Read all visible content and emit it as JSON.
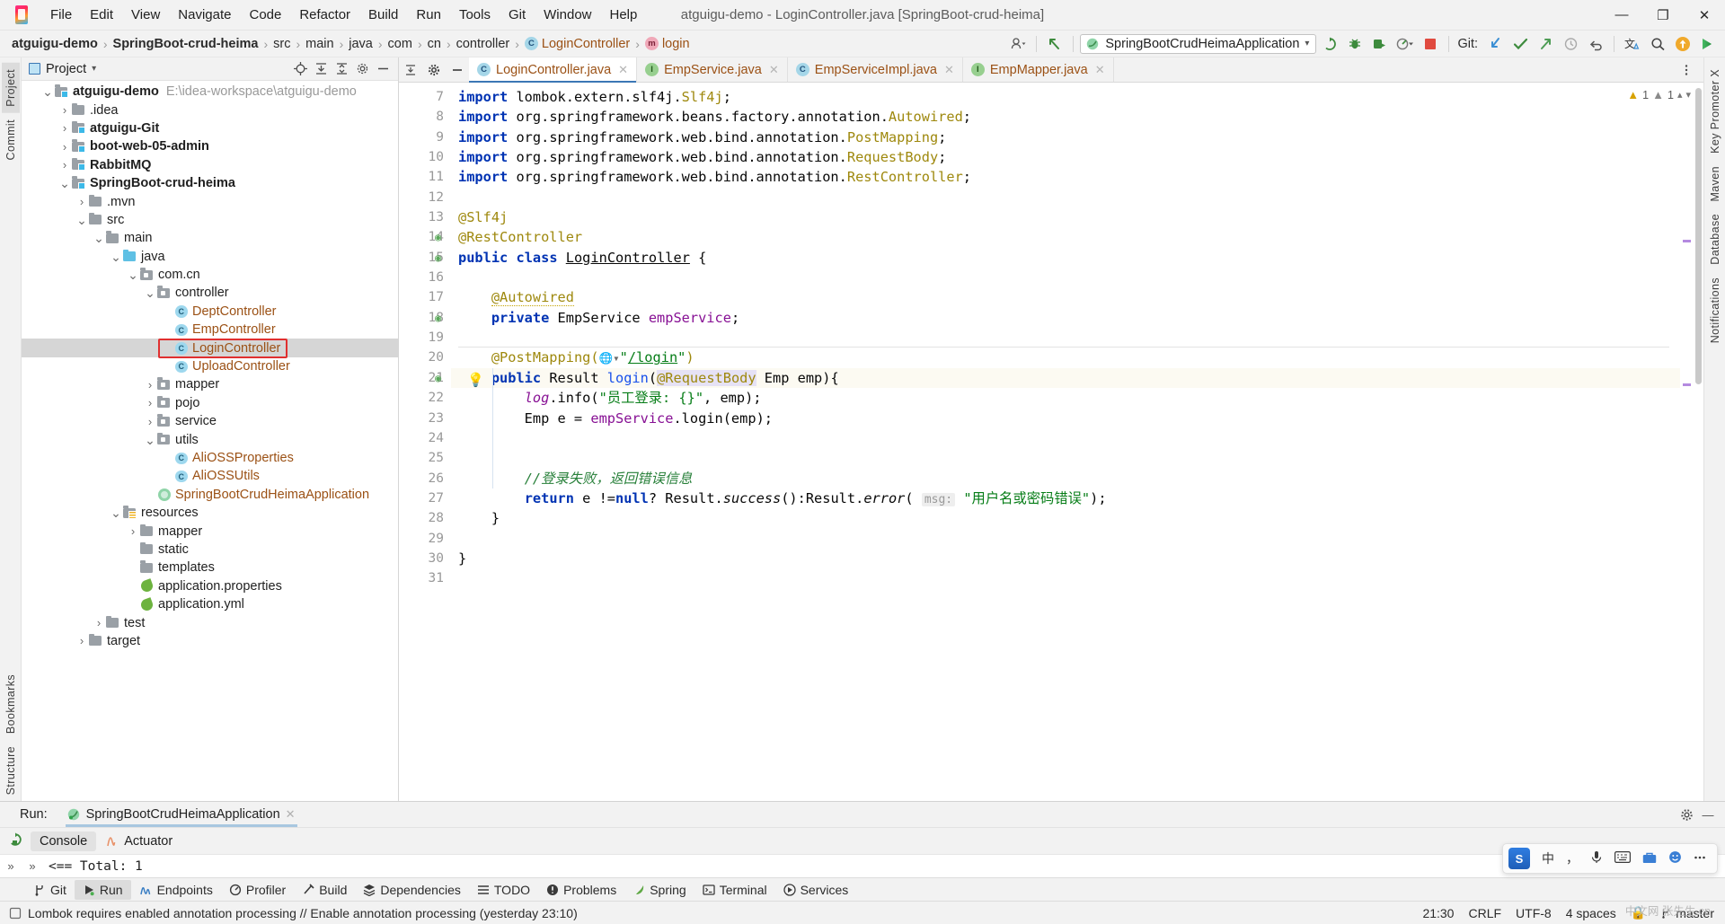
{
  "titlebar": {
    "window_title": "atguigu-demo - LoginController.java [SpringBoot-crud-heima]",
    "menus": [
      "File",
      "Edit",
      "View",
      "Navigate",
      "Code",
      "Refactor",
      "Build",
      "Run",
      "Tools",
      "Git",
      "Window",
      "Help"
    ],
    "minimize": "—",
    "maximize": "❐",
    "close": "✕"
  },
  "navbar": {
    "crumbs": [
      {
        "label": "atguigu-demo",
        "style": "bold"
      },
      {
        "label": "SpringBoot-crud-heima",
        "style": "bold"
      },
      {
        "label": "src",
        "style": "plain"
      },
      {
        "label": "main",
        "style": "plain"
      },
      {
        "label": "java",
        "style": "plain"
      },
      {
        "label": "com",
        "style": "plain"
      },
      {
        "label": "cn",
        "style": "plain"
      },
      {
        "label": "controller",
        "style": "plain"
      },
      {
        "label": "LoginController",
        "style": "class",
        "icon": "c"
      },
      {
        "label": "login",
        "style": "method",
        "icon": "m"
      }
    ],
    "separator": "›",
    "run_config": "SpringBootCrudHeimaApplication",
    "run_config_caret": "▾",
    "git_label": "Git:",
    "toolbar_icons": [
      "user-avatar-icon",
      "undo-arrow-icon",
      "run-icon",
      "debug-icon",
      "run-coverage-icon",
      "profiler-icon",
      "stop-icon",
      "git-update-icon",
      "git-commit-icon",
      "git-push-icon",
      "history-icon",
      "rollback-icon",
      "translate-icon",
      "search-icon",
      "updates-icon",
      "feature-trainer-icon"
    ]
  },
  "left_rail": {
    "tabs": [
      "Project",
      "Commit"
    ],
    "bottom_tabs": [
      "Bookmarks",
      "Structure"
    ]
  },
  "right_rail": {
    "tabs": [
      "Key Promoter X",
      "Maven",
      "Database",
      "Notifications"
    ]
  },
  "project_panel": {
    "title": "Project",
    "caret": "▾",
    "header_icons": [
      "locate-icon",
      "collapse-all-icon",
      "expand-all-icon",
      "settings-icon",
      "hide-icon"
    ],
    "tree": [
      {
        "depth": 0,
        "arrow": "v",
        "icon": "module",
        "label": "atguigu-demo",
        "bold": true,
        "path": "E:\\idea-workspace\\atguigu-demo"
      },
      {
        "depth": 1,
        "arrow": ">",
        "icon": "folder",
        "label": ".idea",
        "bold": false
      },
      {
        "depth": 1,
        "arrow": ">",
        "icon": "module",
        "label": "atguigu-Git",
        "bold": true
      },
      {
        "depth": 1,
        "arrow": ">",
        "icon": "module",
        "label": "boot-web-05-admin",
        "bold": true
      },
      {
        "depth": 1,
        "arrow": ">",
        "icon": "module",
        "label": "RabbitMQ",
        "bold": true
      },
      {
        "depth": 1,
        "arrow": "v",
        "icon": "module",
        "label": "SpringBoot-crud-heima",
        "bold": true
      },
      {
        "depth": 2,
        "arrow": ">",
        "icon": "folder",
        "label": ".mvn",
        "bold": false
      },
      {
        "depth": 2,
        "arrow": "v",
        "icon": "folder",
        "label": "src",
        "bold": false
      },
      {
        "depth": 3,
        "arrow": "v",
        "icon": "folder",
        "label": "main",
        "bold": false
      },
      {
        "depth": 4,
        "arrow": "v",
        "icon": "source",
        "label": "java",
        "bold": false
      },
      {
        "depth": 5,
        "arrow": "v",
        "icon": "package",
        "label": "com.cn",
        "bold": false
      },
      {
        "depth": 6,
        "arrow": "v",
        "icon": "package",
        "label": "controller",
        "bold": false
      },
      {
        "depth": 7,
        "arrow": "",
        "icon": "class",
        "label": "DeptController",
        "bold": false
      },
      {
        "depth": 7,
        "arrow": "",
        "icon": "class",
        "label": "EmpController",
        "bold": false
      },
      {
        "depth": 7,
        "arrow": "",
        "icon": "class",
        "label": "LoginController",
        "bold": false,
        "selected": true,
        "highlight": true
      },
      {
        "depth": 7,
        "arrow": "",
        "icon": "class",
        "label": "UploadController",
        "bold": false
      },
      {
        "depth": 6,
        "arrow": ">",
        "icon": "package",
        "label": "mapper",
        "bold": false
      },
      {
        "depth": 6,
        "arrow": ">",
        "icon": "package",
        "label": "pojo",
        "bold": false
      },
      {
        "depth": 6,
        "arrow": ">",
        "icon": "package",
        "label": "service",
        "bold": false
      },
      {
        "depth": 6,
        "arrow": "v",
        "icon": "package",
        "label": "utils",
        "bold": false
      },
      {
        "depth": 7,
        "arrow": "",
        "icon": "class",
        "label": "AliOSSProperties",
        "bold": false
      },
      {
        "depth": 7,
        "arrow": "",
        "icon": "class",
        "label": "AliOSSUtils",
        "bold": false
      },
      {
        "depth": 6,
        "arrow": "",
        "icon": "spring",
        "label": "SpringBootCrudHeimaApplication",
        "bold": false
      },
      {
        "depth": 4,
        "arrow": "v",
        "icon": "resource",
        "label": "resources",
        "bold": false
      },
      {
        "depth": 5,
        "arrow": ">",
        "icon": "folder",
        "label": "mapper",
        "bold": false
      },
      {
        "depth": 5,
        "arrow": "",
        "icon": "folder",
        "label": "static",
        "bold": false
      },
      {
        "depth": 5,
        "arrow": "",
        "icon": "folder",
        "label": "templates",
        "bold": false
      },
      {
        "depth": 5,
        "arrow": "",
        "icon": "props",
        "label": "application.properties",
        "bold": false
      },
      {
        "depth": 5,
        "arrow": "",
        "icon": "props",
        "label": "application.yml",
        "bold": false
      },
      {
        "depth": 3,
        "arrow": ">",
        "icon": "folder",
        "label": "test",
        "bold": false
      },
      {
        "depth": 2,
        "arrow": ">",
        "icon": "folder",
        "label": "target",
        "bold": false
      }
    ]
  },
  "editor": {
    "tabs": [
      {
        "label": "LoginController.java",
        "icon": "c",
        "active": true
      },
      {
        "label": "EmpService.java",
        "icon": "i",
        "active": false
      },
      {
        "label": "EmpServiceImpl.java",
        "icon": "c",
        "active": false
      },
      {
        "label": "EmpMapper.java",
        "icon": "i",
        "active": false
      }
    ],
    "close_glyph": "✕",
    "inspection": {
      "warnings": "1",
      "weak_warnings": "1",
      "warn_glyph": "⚠",
      "check_glyph": "✓"
    },
    "first_line_number": 7,
    "lines": [
      {
        "n": 7,
        "text": "import lombok.extern.slf4j.Slf4j;"
      },
      {
        "n": 8,
        "text": "import org.springframework.beans.factory.annotation.Autowired;"
      },
      {
        "n": 9,
        "text": "import org.springframework.web.bind.annotation.PostMapping;"
      },
      {
        "n": 10,
        "text": "import org.springframework.web.bind.annotation.RequestBody;"
      },
      {
        "n": 11,
        "text": "import org.springframework.web.bind.annotation.RestController;"
      },
      {
        "n": 12,
        "text": ""
      },
      {
        "n": 13,
        "text": "@Slf4j"
      },
      {
        "n": 14,
        "text": "@RestController"
      },
      {
        "n": 15,
        "text": "public class LoginController {"
      },
      {
        "n": 16,
        "text": ""
      },
      {
        "n": 17,
        "text": "    @Autowired"
      },
      {
        "n": 18,
        "text": "    private EmpService empService;"
      },
      {
        "n": 19,
        "text": ""
      },
      {
        "n": 20,
        "text": "    @PostMapping(\"/login\")"
      },
      {
        "n": 21,
        "text": "    public Result login(@RequestBody Emp emp){"
      },
      {
        "n": 22,
        "text": "        log.info(\"员工登录: {}\", emp);"
      },
      {
        "n": 23,
        "text": "        Emp e = empService.login(emp);"
      },
      {
        "n": 24,
        "text": ""
      },
      {
        "n": 25,
        "text": ""
      },
      {
        "n": 26,
        "text": "        //登录失败，返回错误信息"
      },
      {
        "n": 27,
        "text": "        return e !=null? Result.success():Result.error( msg: \"用户名或密码错误\");"
      },
      {
        "n": 28,
        "text": "    }"
      },
      {
        "n": 29,
        "text": ""
      },
      {
        "n": 30,
        "text": "}"
      },
      {
        "n": 31,
        "text": ""
      }
    ],
    "param_hint": "msg:",
    "url_literal": "/login",
    "globe_glyph": "ἱ0"
  },
  "run_panel": {
    "label": "Run:",
    "config_name": "SpringBootCrudHeimaApplication",
    "close_glyph": "✕",
    "tabs": [
      "Console",
      "Actuator"
    ],
    "active_tab": "Console",
    "console_line": "<==      Total: 1",
    "chevrons": [
      "»",
      "»"
    ],
    "settings_glyph": "⚙",
    "hide_glyph": "—"
  },
  "toolwindow_bar": {
    "items": [
      {
        "label": "Git",
        "icon": "git-branch-icon",
        "active": false
      },
      {
        "label": "Run",
        "icon": "run-play-icon",
        "active": true
      },
      {
        "label": "Endpoints",
        "icon": "endpoints-icon",
        "active": false
      },
      {
        "label": "Profiler",
        "icon": "profiler-icon",
        "active": false
      },
      {
        "label": "Build",
        "icon": "build-hammer-icon",
        "active": false
      },
      {
        "label": "Dependencies",
        "icon": "dependencies-icon",
        "active": false
      },
      {
        "label": "TODO",
        "icon": "todo-list-icon",
        "active": false
      },
      {
        "label": "Problems",
        "icon": "problems-icon",
        "active": false
      },
      {
        "label": "Spring",
        "icon": "spring-leaf-icon",
        "active": false
      },
      {
        "label": "Terminal",
        "icon": "terminal-icon",
        "active": false
      },
      {
        "label": "Services",
        "icon": "services-icon",
        "active": false
      }
    ]
  },
  "status_bar": {
    "message": "Lombok requires enabled annotation processing // Enable annotation processing (yesterday 23:10)",
    "time": "21:30",
    "line_sep": "CRLF",
    "encoding": "UTF-8",
    "indent": "4 spaces",
    "branch": "master",
    "lock_glyph": "⌂",
    "branch_glyph": "⎇"
  },
  "ime_bar": {
    "logo": "S",
    "mode": "中",
    "items": [
      "comma-icon",
      "mic-icon",
      "keyboard-icon",
      "toolbox-icon",
      "smile-icon",
      "more-icon"
    ]
  },
  "watermark": "中文网 张先生.cn",
  "colors": {
    "accent_blue": "#3b77b5",
    "class_orange": "#9b5115",
    "keyword_blue": "#0033b3",
    "string_green": "#067d17",
    "annotation_yellow": "#9e880d",
    "field_purple": "#871094",
    "selection_red": "#e03030",
    "comment_green": "#28803a"
  }
}
